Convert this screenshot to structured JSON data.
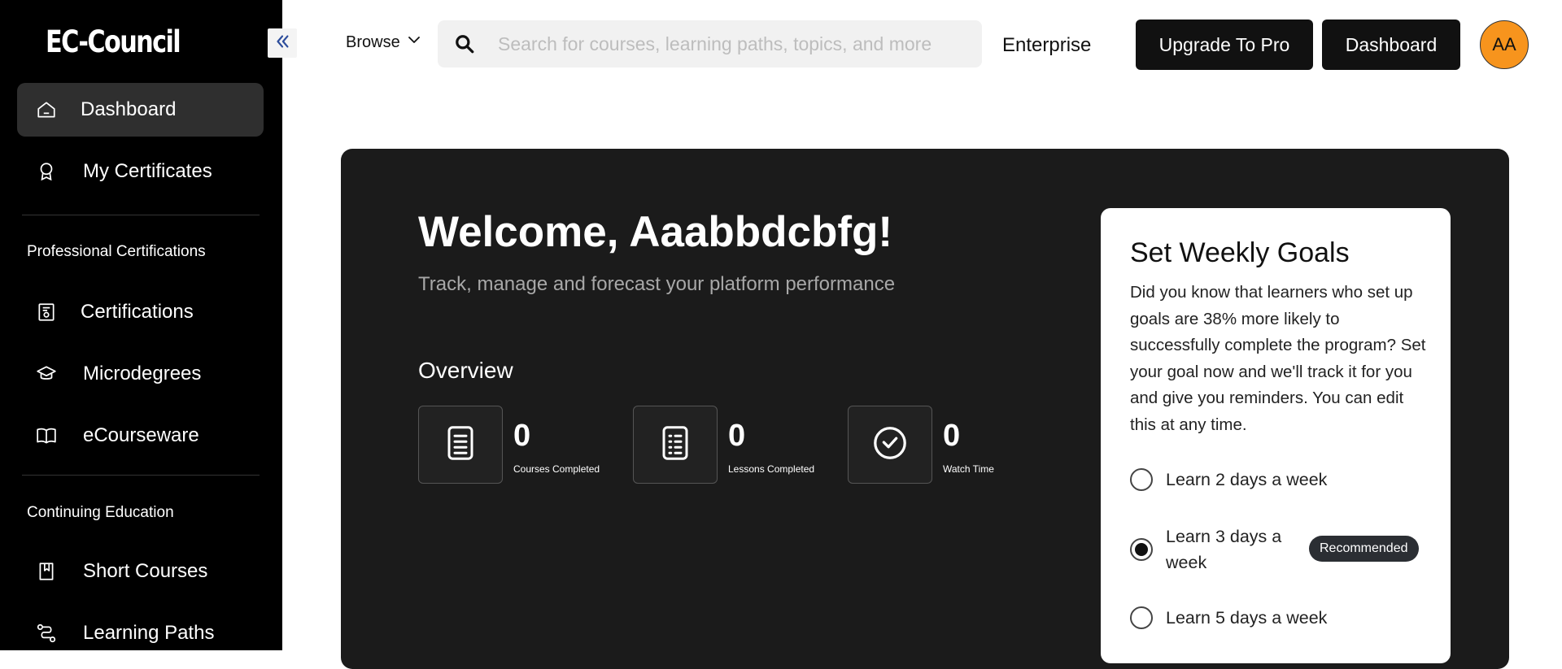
{
  "sidebar": {
    "logo": "EC-Council",
    "collapse_label": "«",
    "items": [
      {
        "label": "Dashboard",
        "icon": "home-icon",
        "active": true
      },
      {
        "label": "My Certificates",
        "icon": "award-icon"
      }
    ],
    "sections": [
      {
        "title": "Professional Certifications",
        "items": [
          {
            "label": "Certifications",
            "icon": "certificate-icon"
          },
          {
            "label": "Microdegrees",
            "icon": "graduation-cap-icon"
          },
          {
            "label": "eCourseware",
            "icon": "book-open-icon"
          }
        ]
      },
      {
        "title": "Continuing Education",
        "items": [
          {
            "label": "Short Courses",
            "icon": "bookmark-book-icon"
          },
          {
            "label": "Learning Paths",
            "icon": "route-icon"
          }
        ]
      }
    ]
  },
  "header": {
    "browse_label": "Browse",
    "search_placeholder": "Search for courses, learning paths, topics, and more",
    "search_value": "",
    "enterprise_label": "Enterprise",
    "upgrade_label": "Upgrade To Pro",
    "dashboard_label": "Dashboard",
    "avatar_initials": "AA",
    "avatar_color": "#f7941d"
  },
  "hero": {
    "welcome": "Welcome, Aaabbdcbfg!",
    "subtitle": "Track, manage and forecast your platform performance",
    "overview_title": "Overview",
    "stats": [
      {
        "value": "0",
        "label": "Courses Completed",
        "icon": "document-icon"
      },
      {
        "value": "0",
        "label": "Lessons Completed",
        "icon": "checklist-icon"
      },
      {
        "value": "0",
        "label": "Watch Time",
        "icon": "clock-icon"
      }
    ]
  },
  "goals": {
    "title": "Set Weekly Goals",
    "description": "Did you know that learners who set up goals are 38% more likely to successfully complete the program? Set your goal now and we'll track it for you and give you reminders. You can edit this at any time.",
    "options": [
      {
        "label": "Learn 2 days a week",
        "selected": false
      },
      {
        "label": "Learn 3 days a week",
        "selected": true
      },
      {
        "label": "Learn 5 days a week",
        "selected": false
      }
    ],
    "recommended_badge": "Recommended"
  },
  "colors": {
    "sidebar_bg": "#000000",
    "active_item_bg": "#2f2f2f",
    "hero_bg": "#1b1b1b",
    "accent": "#f7941d"
  }
}
